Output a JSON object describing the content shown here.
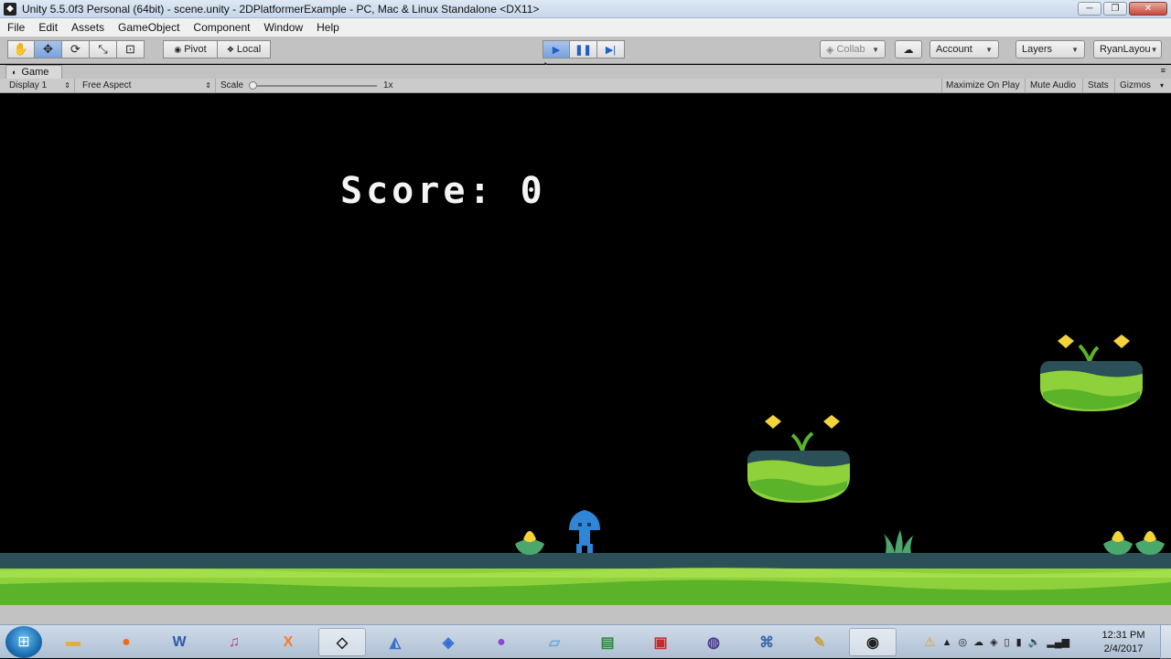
{
  "window": {
    "title": "Unity 5.5.0f3 Personal (64bit) - scene.unity - 2DPlatformerExample - PC, Mac & Linux Standalone <DX11>"
  },
  "menu": [
    "File",
    "Edit",
    "Assets",
    "GameObject",
    "Component",
    "Window",
    "Help"
  ],
  "toolbar": {
    "pivot": "Pivot",
    "local": "Local",
    "collab": "Collab",
    "account": "Account",
    "layers": "Layers",
    "layout": "RyanLayou"
  },
  "game_view": {
    "tab": "Game",
    "display": "Display 1",
    "aspect": "Free Aspect",
    "scale_label": "Scale",
    "scale_value": "1x",
    "maximize": "Maximize On Play",
    "mute": "Mute Audio",
    "stats": "Stats",
    "gizmos": "Gizmos"
  },
  "game": {
    "score": "Score: 0"
  },
  "taskbar": {
    "time": "12:31 PM",
    "date": "2/4/2017"
  },
  "colors": {
    "play_active": "#7aa2dc",
    "grass_light": "#8fd13a",
    "grass_dark": "#5bb32a",
    "ground_top": "#2c5058",
    "character": "#2f86d6",
    "coin": "#f4d43a"
  }
}
